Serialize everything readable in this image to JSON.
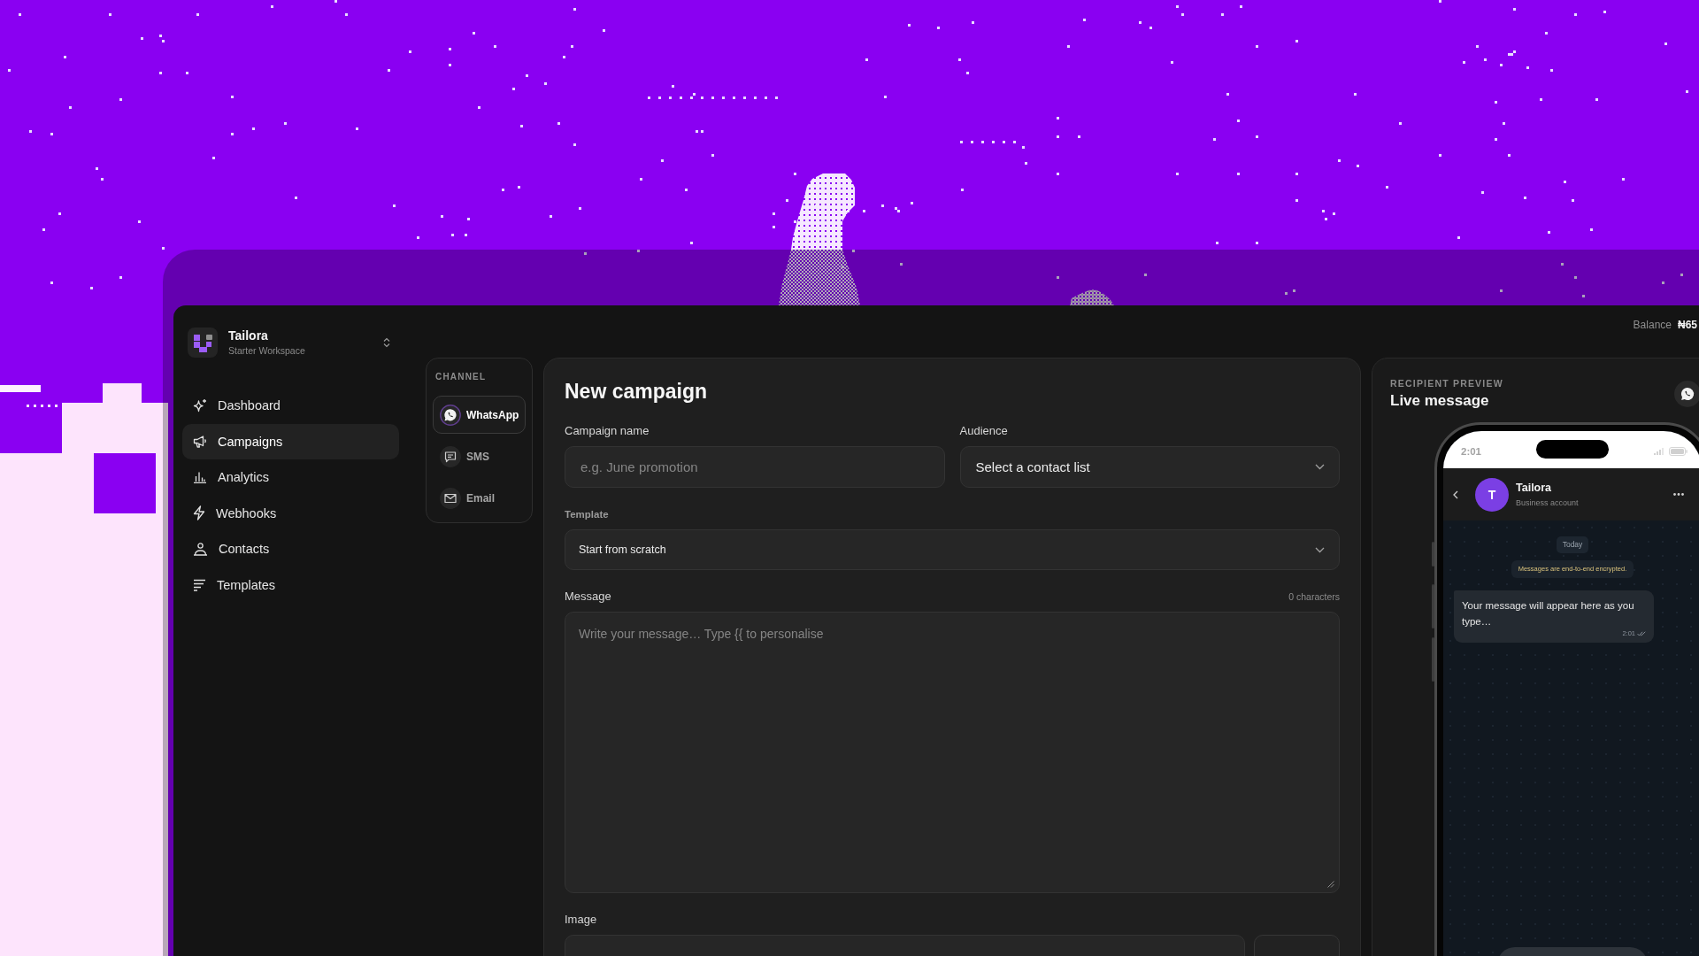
{
  "sidebar": {
    "workspace": {
      "name": "Tailora",
      "plan": "Starter Workspace"
    },
    "items": [
      {
        "label": "Dashboard",
        "selected": false
      },
      {
        "label": "Campaigns",
        "selected": true
      },
      {
        "label": "Analytics",
        "selected": false
      },
      {
        "label": "Webhooks",
        "selected": false
      },
      {
        "label": "Contacts",
        "selected": false
      },
      {
        "label": "Templates",
        "selected": false
      }
    ]
  },
  "top_bar": {
    "balance_label": "Balance",
    "balance_value": "₦65"
  },
  "channels": {
    "title": "CHANNEL",
    "items": [
      {
        "label": "WhatsApp",
        "selected": true
      },
      {
        "label": "SMS",
        "selected": false
      },
      {
        "label": "Email",
        "selected": false
      }
    ]
  },
  "form": {
    "title": "New campaign",
    "rows": [
      {
        "fields": [
          {
            "kind": "input",
            "label": "Campaign name",
            "placeholder": "e.g. June promotion"
          },
          {
            "kind": "select",
            "label": "Audience",
            "value": "Select a contact list"
          }
        ]
      },
      {
        "fields": [
          {
            "kind": "compact-select",
            "label": "Template",
            "value": "Start from scratch"
          }
        ]
      },
      {
        "fields": [
          {
            "kind": "textarea",
            "label": "Message",
            "counter": "0 characters",
            "placeholder": "Write your message… Type {{ to personalise"
          }
        ]
      },
      {
        "fields": [
          {
            "kind": "image",
            "label": "Image"
          }
        ]
      }
    ]
  },
  "preview": {
    "eyebrow": "RECIPIENT PREVIEW",
    "title": "Live message",
    "phone": {
      "time": "2:01",
      "contact_initial": "T",
      "contact_name": "Tailora",
      "contact_subtitle": "Business account",
      "date_chip": "Today",
      "notice": "Messages are end-to-end encrypted.",
      "message": "Your message will appear here as you type…",
      "message_time": "2:01"
    }
  }
}
